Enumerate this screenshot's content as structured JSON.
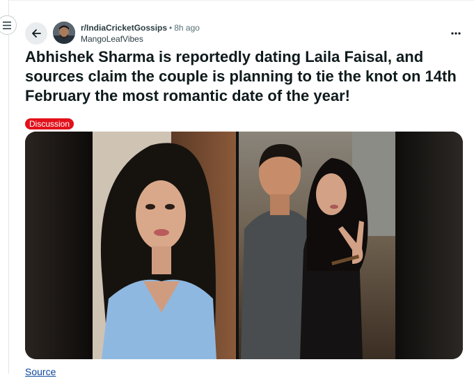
{
  "post": {
    "subreddit": "r/IndiaCricketGossips",
    "separator": "•",
    "time_ago": "8h ago",
    "author": "MangoLeafVibes",
    "title": "Abhishek Sharma is reportedly dating Laila Faisal, and sources claim the couple is planning to tie the knot on 14th February the most romantic date of the year!",
    "flair": "Discussion",
    "source_link": "Source"
  },
  "icons": {
    "menu": "hamburger-icon",
    "back": "arrow-left-icon",
    "more": "overflow-dots-icon"
  },
  "colors": {
    "flair_bg": "#e2101a",
    "link": "#0a449b",
    "title": "#0f1a1c"
  }
}
